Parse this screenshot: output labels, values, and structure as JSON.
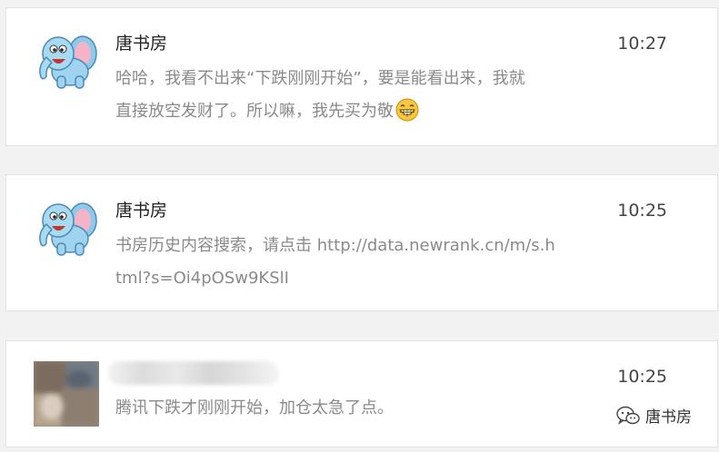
{
  "messages": [
    {
      "sender": "唐书房",
      "time": "10:27",
      "line1": "哈哈，我看不出来“下跌刚刚开始”，要是能看出来，我就",
      "line2": "直接放空发财了。所以嘛，我先买为敬",
      "emoji": "grin-emoji"
    },
    {
      "sender": "唐书房",
      "time": "10:25",
      "line1": "书房历史内容搜索，请点击 http://data.newrank.cn/m/s.h",
      "line2": "tml?s=Oi4pOSw9KSlI"
    },
    {
      "sender": "",
      "time": "10:25",
      "line1": "腾讯下跌才刚刚开始，加仓太急了点。"
    }
  ],
  "watermark": {
    "text": "唐书房",
    "icon": "wechat-icon"
  },
  "colors": {
    "background": "#f2f2f2",
    "card": "#ffffff",
    "message_text": "#8a8a8a",
    "name_text": "#222222"
  }
}
